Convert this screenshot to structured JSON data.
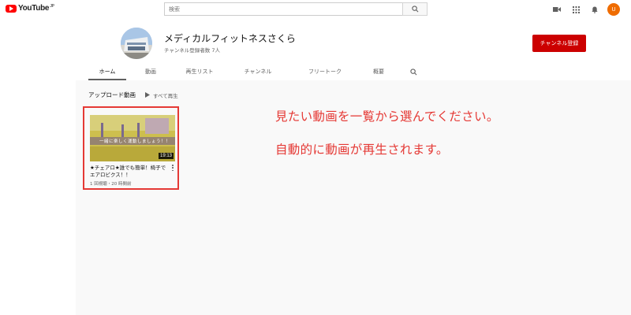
{
  "header": {
    "logo_text": "YouTube",
    "logo_sup": "JP",
    "search_placeholder": "検索",
    "icons": [
      "video-camera-icon",
      "apps-grid-icon",
      "bell-icon"
    ],
    "avatar_letter": "U",
    "accent_color": "#ff0000"
  },
  "channel": {
    "name": "メディカルフィットネスさくら",
    "subscribers": "チャンネル登録者数 7人",
    "subscribe_label": "チャンネル登録",
    "subscribe_color": "#cc0000"
  },
  "tabs": [
    {
      "label": "ホーム",
      "active": true
    },
    {
      "label": "動画"
    },
    {
      "label": "再生リスト"
    },
    {
      "label": "チャンネル"
    },
    {
      "label": "フリートーク"
    },
    {
      "label": "概要"
    }
  ],
  "section": {
    "title": "アップロード動画",
    "play_all": "すべて再生"
  },
  "video": {
    "thumb_caption": "一緒に楽しく運動しましょう！！",
    "duration": "19:13",
    "title": "★チェアロ★誰でも簡単！椅子でエアロビクス！！",
    "meta": "1 回視聴・20 時間前"
  },
  "annotation": {
    "line1": "見たい動画を一覧から選んでください。",
    "line2": "自動的に動画が再生されます。",
    "color": "#e53935"
  }
}
